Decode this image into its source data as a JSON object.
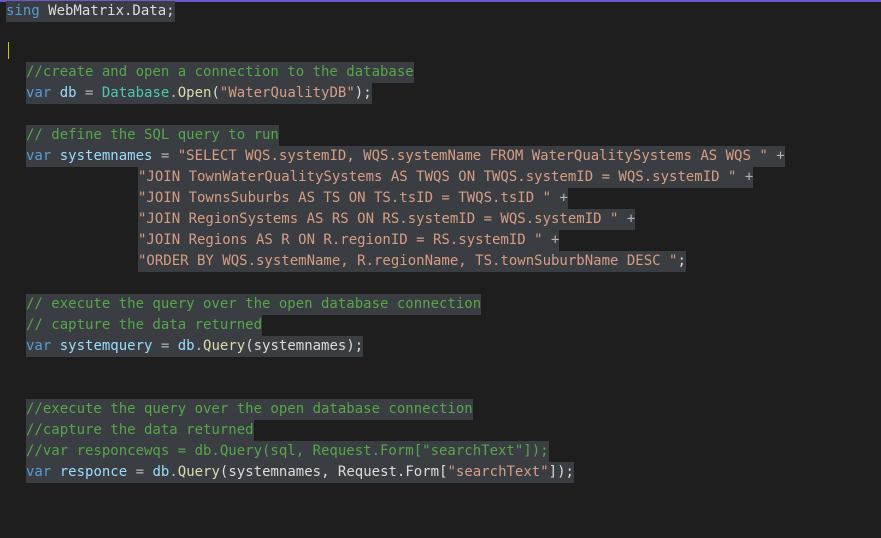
{
  "code": {
    "l1": {
      "kw": "sing",
      "rest": " WebMatrix.Data;"
    },
    "c1": "//create and open a connection to the database",
    "l3": {
      "kw": "var",
      "name": " db ",
      "eq": "=",
      "cls": " Database",
      "dot": ".",
      "fn": "Open",
      "p1": "(",
      "str": "\"WaterQualityDB\"",
      "p2": ");"
    },
    "c2": "// define the SQL query to run",
    "l5": {
      "kw": "var",
      "name": " systemnames ",
      "eq": "=",
      "str": " \"SELECT WQS.systemID, WQS.systemName FROM WaterQualitySystems AS WQS \"",
      "plus": " +"
    },
    "s1": "\"JOIN TownWaterQualitySystems AS TWQS ON TWQS.systemID = WQS.systemID \"",
    "s2": "\"JOIN TownsSuburbs AS TS ON TS.tsID = TWQS.tsID \"",
    "s3": "\"JOIN RegionSystems AS RS ON RS.systemID = WQS.systemID \"",
    "s4": "\"JOIN Regions AS R ON R.regionID = RS.systemID \"",
    "s5": "\"ORDER BY WQS.systemName, R.regionName, TS.townSuburbName DESC \"",
    "plus": " +",
    "semi": ";",
    "c3": "// execute the query over the open database connection",
    "c4": "// capture the data returned",
    "l13": {
      "kw": "var",
      "name": " systemquery ",
      "eq": "=",
      "obj": " db",
      "dot": ".",
      "fn": "Query",
      "args": "(systemnames);"
    },
    "c5": "//execute the query over the open database connection",
    "c6": "//capture the data returned",
    "c7": "//var responcewqs = db.Query(sql, Request.Form[\"searchText\"]);",
    "l18": {
      "kw": "var",
      "name": " responce ",
      "eq": "=",
      "obj": " db",
      "dot": ".",
      "fn": "Query",
      "args1": "(systemnames, Request.Form[",
      "str": "\"searchText\"",
      "args2": "]);"
    }
  }
}
